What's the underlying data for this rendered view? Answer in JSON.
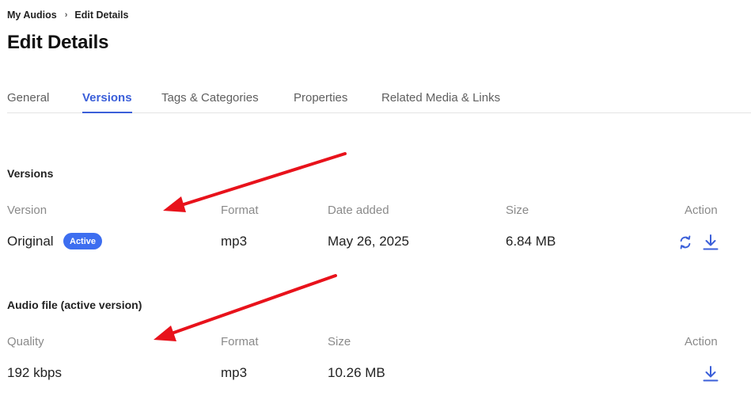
{
  "breadcrumb": {
    "parent": "My Audios",
    "separator": "›",
    "current": "Edit Details"
  },
  "page": {
    "title": "Edit Details"
  },
  "tabs": [
    {
      "label": "General",
      "active": false
    },
    {
      "label": "Versions",
      "active": true
    },
    {
      "label": "Tags & Categories",
      "active": false
    },
    {
      "label": "Properties",
      "active": false
    },
    {
      "label": "Related Media & Links",
      "active": false
    }
  ],
  "versions": {
    "title": "Versions",
    "columns": {
      "version": "Version",
      "format": "Format",
      "date": "Date added",
      "size": "Size",
      "action": "Action"
    },
    "rows": [
      {
        "version": "Original",
        "badge": "Active",
        "format": "mp3",
        "date": "May 26, 2025",
        "size": "6.84 MB",
        "actions": [
          "replace-icon",
          "download-icon"
        ]
      }
    ]
  },
  "audio_file": {
    "title": "Audio file (active version)",
    "columns": {
      "quality": "Quality",
      "format": "Format",
      "size": "Size",
      "action": "Action"
    },
    "rows": [
      {
        "quality": "192 kbps",
        "format": "mp3",
        "size": "10.26 MB",
        "actions": [
          "download-icon"
        ]
      }
    ]
  },
  "colors": {
    "accent": "#3b5fd9",
    "badge": "#3d6ef0",
    "annotation_arrow": "#e8121b",
    "muted_text": "#8a8a8a"
  }
}
